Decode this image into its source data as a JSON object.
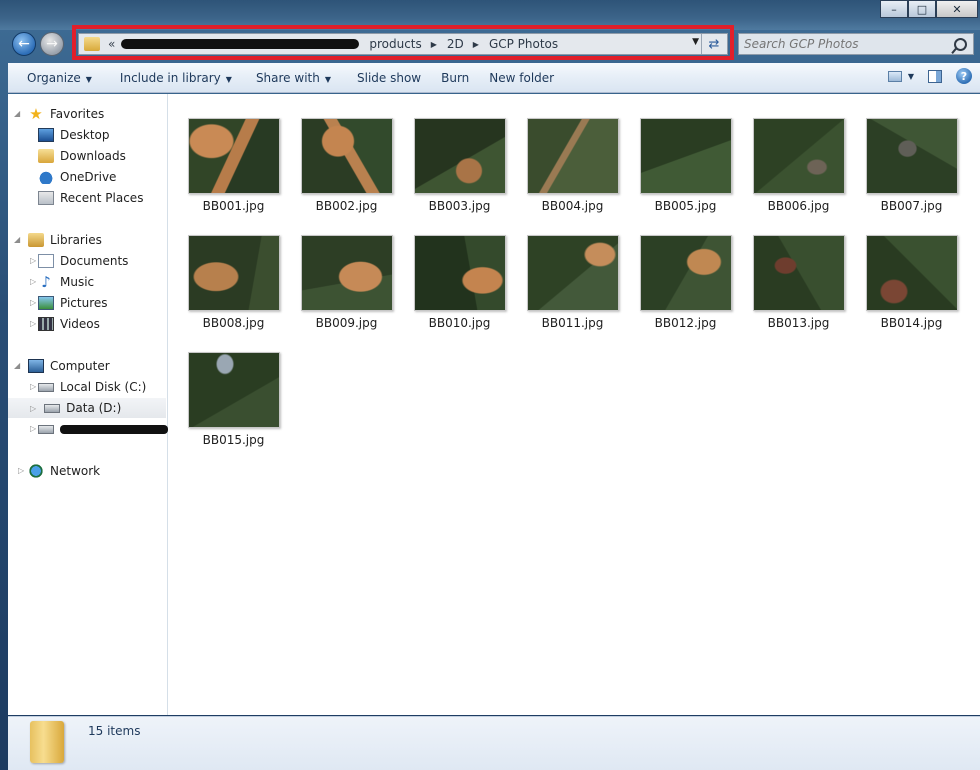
{
  "window": {
    "minimize": "–",
    "maximize": "□",
    "close": "✕"
  },
  "nav": {
    "back": "←",
    "forward": "→"
  },
  "address": {
    "overflow": "«",
    "crumbs": [
      "products",
      "2D",
      "GCP Photos"
    ],
    "separator": "▶",
    "dropdown": "▼",
    "refresh": "⇄"
  },
  "search": {
    "placeholder": "Search GCP Photos"
  },
  "toolbar": {
    "organize": "Organize",
    "include_in_library": "Include in library",
    "share_with": "Share with",
    "slide_show": "Slide show",
    "burn": "Burn",
    "new_folder": "New folder",
    "dropdown_arrow": "▼",
    "help": "?"
  },
  "sidebar": {
    "expand_glyph": "▷",
    "collapse_glyph": "◢",
    "favorites": {
      "label": "Favorites",
      "items": [
        "Desktop",
        "Downloads",
        "OneDrive",
        "Recent Places"
      ]
    },
    "libraries": {
      "label": "Libraries",
      "items": [
        "Documents",
        "Music",
        "Pictures",
        "Videos"
      ]
    },
    "computer": {
      "label": "Computer",
      "items": [
        "Local Disk (C:)",
        "Data (D:)"
      ]
    },
    "network": {
      "label": "Network"
    }
  },
  "files": [
    "BB001.jpg",
    "BB002.jpg",
    "BB003.jpg",
    "BB004.jpg",
    "BB005.jpg",
    "BB006.jpg",
    "BB007.jpg",
    "BB008.jpg",
    "BB009.jpg",
    "BB010.jpg",
    "BB011.jpg",
    "BB012.jpg",
    "BB013.jpg",
    "BB014.jpg",
    "BB015.jpg"
  ],
  "status": {
    "item_count": "15 items"
  },
  "colors": {
    "highlight": "#e11f2a",
    "selection": "#e5e8ec"
  }
}
